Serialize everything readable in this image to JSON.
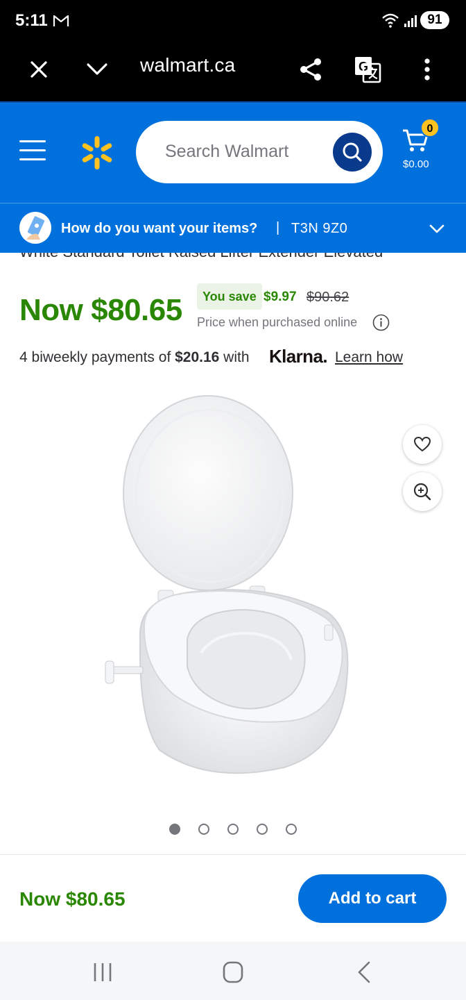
{
  "status_bar": {
    "time": "5:11",
    "battery": "91"
  },
  "browser": {
    "url": "walmart.ca"
  },
  "header": {
    "search_placeholder": "Search Walmart",
    "cart_count": "0",
    "cart_total": "$0.00"
  },
  "fulfillment": {
    "question": "How do you want your items?",
    "separator": "|",
    "postal_code": "T3N 9Z0"
  },
  "product": {
    "title_partial": "White Standard Toilet Raised Lifter Extender Elevated",
    "price_now": "Now $80.65",
    "you_save_label": "You save",
    "save_amount": "$9.97",
    "was_price": "$90.62",
    "price_note": "Price when purchased online",
    "klarna_prefix": "4 biweekly payments of ",
    "klarna_amount": "$20.16",
    "klarna_with": " with",
    "klarna_brand": "Klarna.",
    "klarna_link": "Learn how",
    "image_count": 5,
    "active_image": 1
  },
  "sticky": {
    "price": "Now $80.65",
    "add_to_cart": "Add to cart"
  },
  "colors": {
    "walmart_blue": "#0071dc",
    "spark_yellow": "#ffc220",
    "price_green": "#2a8703",
    "search_button": "#0a3a8c"
  }
}
